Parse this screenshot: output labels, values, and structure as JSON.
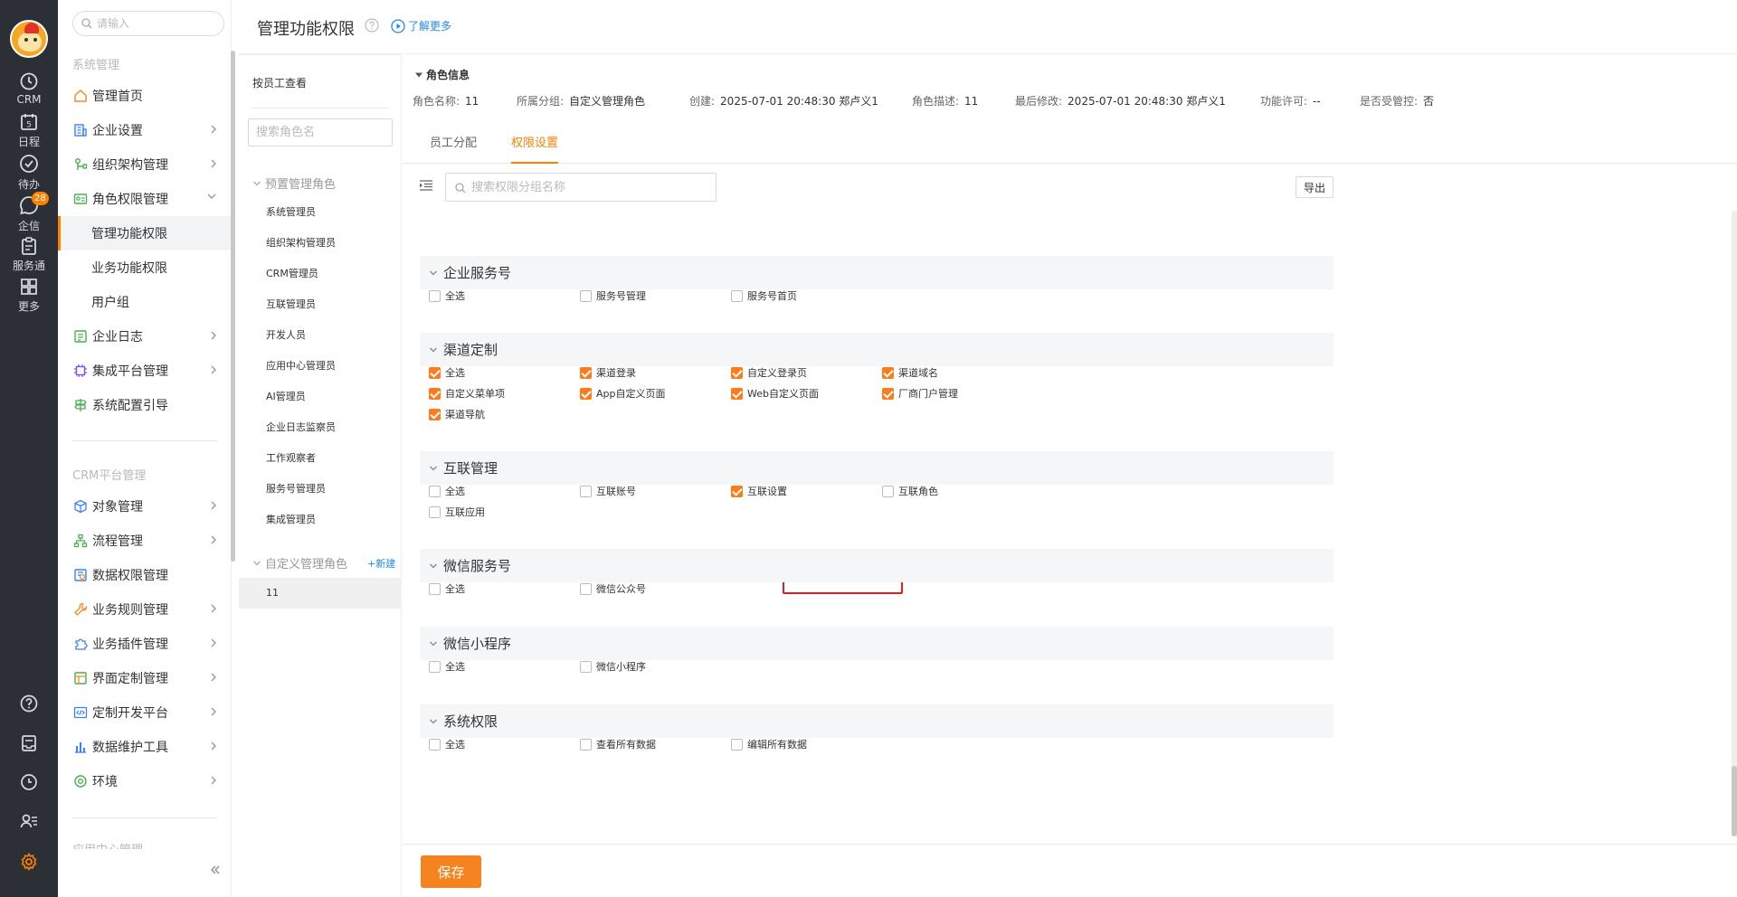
{
  "rail": {
    "items": [
      {
        "label": "CRM",
        "icon": "clock-icon"
      },
      {
        "label": "日程",
        "icon": "calendar-icon",
        "day": "5"
      },
      {
        "label": "待办",
        "icon": "check-circle-icon"
      },
      {
        "label": "企信",
        "icon": "chat-icon",
        "badge": "28"
      },
      {
        "label": "服务通",
        "icon": "clipboard-icon"
      },
      {
        "label": "更多",
        "icon": "grid-icon"
      }
    ]
  },
  "nav": {
    "search_placeholder": "请输入",
    "section1": "系统管理",
    "items1": [
      {
        "label": "管理首页",
        "icon": "home-icon"
      },
      {
        "label": "企业设置",
        "icon": "building-icon"
      },
      {
        "label": "组织架构管理",
        "icon": "org-icon"
      },
      {
        "label": "角色权限管理",
        "icon": "role-card-icon"
      },
      {
        "label": "管理功能权限"
      },
      {
        "label": "业务功能权限"
      },
      {
        "label": "用户组"
      },
      {
        "label": "企业日志",
        "icon": "log-icon"
      },
      {
        "label": "集成平台管理",
        "icon": "chip-icon"
      },
      {
        "label": "系统配置引导",
        "icon": "signpost-icon"
      }
    ],
    "section2": "CRM平台管理",
    "items2": [
      {
        "label": "对象管理",
        "icon": "cube-icon"
      },
      {
        "label": "流程管理",
        "icon": "flow-icon"
      },
      {
        "label": "数据权限管理",
        "icon": "data-permission-icon"
      },
      {
        "label": "业务规则管理",
        "icon": "wrench-icon"
      },
      {
        "label": "业务插件管理",
        "icon": "puzzle-icon"
      },
      {
        "label": "界面定制管理",
        "icon": "layout-icon"
      },
      {
        "label": "定制开发平台",
        "icon": "code-icon"
      },
      {
        "label": "数据维护工具",
        "icon": "bar-chart-icon"
      },
      {
        "label": "环境",
        "icon": "environment-icon"
      }
    ],
    "section3_partial": "应用中心管理"
  },
  "header": {
    "title": "管理功能权限",
    "learn_more": "了解更多"
  },
  "roles": {
    "view_by": "按员工查看",
    "search_placeholder": "搜索角色名",
    "preset_group": "预置管理角色",
    "preset": [
      "系统管理员",
      "组织架构管理员",
      "CRM管理员",
      "互联管理员",
      "开发人员",
      "应用中心管理员",
      "AI管理员",
      "企业日志监察员",
      "工作观察者",
      "服务号管理员",
      "集成管理员"
    ],
    "custom_group": "自定义管理角色",
    "new_label": "+新建",
    "custom": [
      "11"
    ]
  },
  "role_info": {
    "title": "角色信息",
    "fields": [
      {
        "k": "角色名称:",
        "v": "11"
      },
      {
        "k": "所属分组:",
        "v": "自定义管理角色"
      },
      {
        "k": "创建:",
        "v": "2025-07-01 20:48:30 郑卢义1"
      },
      {
        "k": "角色描述:",
        "v": "11"
      },
      {
        "k": "最后修改:",
        "v": "2025-07-01 20:48:30 郑卢义1"
      },
      {
        "k": "功能许可:",
        "v": "--"
      },
      {
        "k": "是否受管控:",
        "v": "否"
      }
    ]
  },
  "tabs": [
    "员工分配",
    "权限设置"
  ],
  "active_tab": "权限设置",
  "perm_search_placeholder": "搜索权限分组名称",
  "export_label": "导出",
  "sections": [
    {
      "title": "企业服务号",
      "items": [
        {
          "label": "全选",
          "checked": false
        },
        {
          "label": "服务号管理",
          "checked": false
        },
        {
          "label": "服务号首页",
          "checked": false
        }
      ]
    },
    {
      "title": "渠道定制",
      "items": [
        {
          "label": "全选",
          "checked": true
        },
        {
          "label": "渠道登录",
          "checked": true
        },
        {
          "label": "自定义登录页",
          "checked": true
        },
        {
          "label": "渠道域名",
          "checked": true
        },
        {
          "label": "自定义菜单项",
          "checked": true
        },
        {
          "label": "App自定义页面",
          "checked": true
        },
        {
          "label": "Web自定义页面",
          "checked": true
        },
        {
          "label": "厂商门户管理",
          "checked": true
        },
        {
          "label": "渠道导航",
          "checked": true
        }
      ]
    },
    {
      "title": "互联管理",
      "items": [
        {
          "label": "全选",
          "checked": false
        },
        {
          "label": "互联账号",
          "checked": false
        },
        {
          "label": "互联设置",
          "checked": true
        },
        {
          "label": "互联角色",
          "checked": false
        },
        {
          "label": "互联应用",
          "checked": false
        }
      ]
    },
    {
      "title": "微信服务号",
      "items": [
        {
          "label": "全选",
          "checked": false
        },
        {
          "label": "微信公众号",
          "checked": false
        }
      ]
    },
    {
      "title": "微信小程序",
      "items": [
        {
          "label": "全选",
          "checked": false
        },
        {
          "label": "微信小程序",
          "checked": false
        }
      ]
    },
    {
      "title": "系统权限",
      "items": [
        {
          "label": "全选",
          "checked": false
        },
        {
          "label": "查看所有数据",
          "checked": false
        },
        {
          "label": "编辑所有数据",
          "checked": false
        }
      ]
    }
  ],
  "save_label": "保存",
  "colors": {
    "accent": "#ff8000",
    "link": "#1f8ae8",
    "rail_bg": "#2c2f36",
    "highlight": "#e02020"
  }
}
